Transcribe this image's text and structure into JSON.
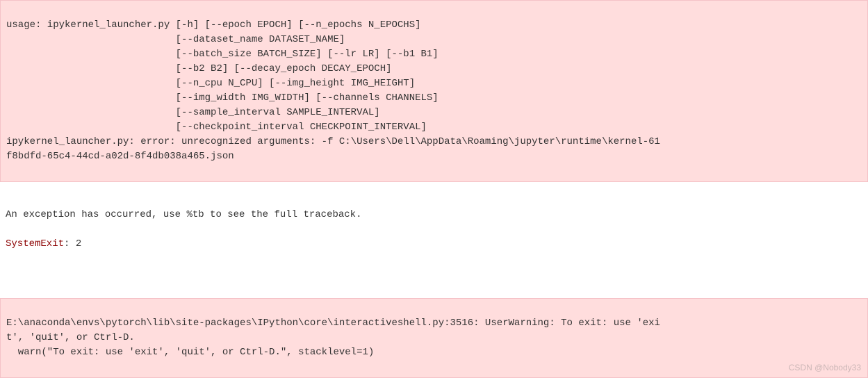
{
  "error_output": {
    "usage_header": "usage: ipykernel_launcher.py [-h] [--epoch EPOCH] [--n_epochs N_EPOCHS]",
    "usage_line2": "                             [--dataset_name DATASET_NAME]",
    "usage_line3": "                             [--batch_size BATCH_SIZE] [--lr LR] [--b1 B1]",
    "usage_line4": "                             [--b2 B2] [--decay_epoch DECAY_EPOCH]",
    "usage_line5": "                             [--n_cpu N_CPU] [--img_height IMG_HEIGHT]",
    "usage_line6": "                             [--img_width IMG_WIDTH] [--channels CHANNELS]",
    "usage_line7": "                             [--sample_interval SAMPLE_INTERVAL]",
    "usage_line8": "                             [--checkpoint_interval CHECKPOINT_INTERVAL]",
    "error_line1": "ipykernel_launcher.py: error: unrecognized arguments: -f C:\\Users\\Dell\\AppData\\Roaming\\jupyter\\runtime\\kernel-61",
    "error_line2": "f8bdfd-65c4-44cd-a02d-8f4db038a465.json"
  },
  "traceback_output": {
    "exception_msg": "An exception has occurred, use %tb to see the full traceback.",
    "system_exit_label": "SystemExit",
    "system_exit_colon": ": ",
    "system_exit_code": "2"
  },
  "warning_output": {
    "line1": "E:\\anaconda\\envs\\pytorch\\lib\\site-packages\\IPython\\core\\interactiveshell.py:3516: UserWarning: To exit: use 'exi",
    "line2": "t', 'quit', or Ctrl-D.",
    "line3": "  warn(\"To exit: use 'exit', 'quit', or Ctrl-D.\", stacklevel=1)"
  },
  "watermark": "CSDN @Nobody33"
}
